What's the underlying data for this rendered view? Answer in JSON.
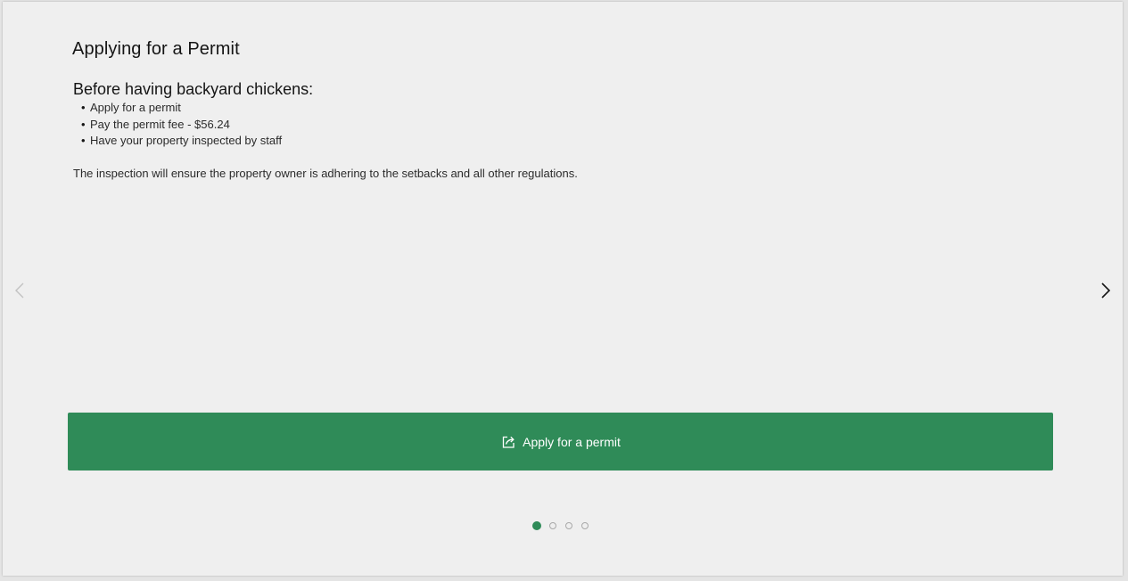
{
  "slide": {
    "title": "Applying for a Permit",
    "subheading": "Before having backyard chickens:",
    "bullets": [
      "Apply for a permit",
      "Pay the permit fee - $56.24",
      "Have your property inspected by staff"
    ],
    "bullet_glyph": "•",
    "paragraph": "The inspection will ensure the property owner is adhering to the setbacks and all other regulations."
  },
  "cta": {
    "label": "Apply for a permit",
    "icon": "external-link-icon",
    "color": "#2f8b58"
  },
  "navigation": {
    "prev_icon": "chevron-left-icon",
    "next_icon": "chevron-right-icon",
    "prev_enabled": false,
    "next_enabled": true
  },
  "pager": {
    "total": 4,
    "current": 1,
    "active_color": "#2f8b58"
  }
}
